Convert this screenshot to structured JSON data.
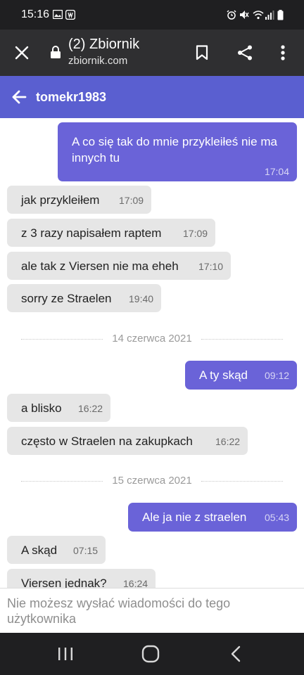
{
  "status_bar": {
    "time": "15:16"
  },
  "browser": {
    "close_icon": "close-icon",
    "lock_icon": "lock-icon",
    "title": "(2) Zbiornik",
    "url": "zbiornik.com",
    "bookmark_icon": "bookmark-icon",
    "share_icon": "share-icon",
    "menu_icon": "more-vert-icon"
  },
  "chat_header": {
    "back_icon": "arrow-left-icon",
    "username": "tomekr1983"
  },
  "messages": [
    {
      "dir": "out",
      "lines": [
        "A co się tak do mnie przykleiłeś nie ma",
        "innych tu"
      ],
      "time": "17:04"
    },
    {
      "dir": "in",
      "text": "jak przykleiłem",
      "time": "17:09"
    },
    {
      "dir": "in",
      "text": "z 3 razy napisałem raptem",
      "time": "17:09"
    },
    {
      "dir": "in",
      "text": "ale tak z Viersen nie ma eheh",
      "time": "17:10"
    },
    {
      "dir": "in",
      "text": "sorry ze Straelen",
      "time": "19:40"
    },
    {
      "date": "14 czerwca 2021"
    },
    {
      "dir": "out",
      "text": "A ty skąd",
      "time": "09:12"
    },
    {
      "dir": "in",
      "text": "a blisko",
      "time": "16:22"
    },
    {
      "dir": "in",
      "text": "często w Straelen na zakupkach",
      "time": "16:22"
    },
    {
      "date": "15 czerwca 2021"
    },
    {
      "dir": "out",
      "text": "Ale ja nie z straelen",
      "time": "05:43"
    },
    {
      "dir": "in",
      "text": "A skąd",
      "time": "07:15"
    },
    {
      "dir": "in",
      "text": "Viersen jednak?",
      "time": "16:24"
    }
  ],
  "compose": {
    "notice": "Nie możesz wysłać wiadomości do tego użytkownika"
  },
  "colors": {
    "accent": "#5a5fd0",
    "outgoing_bubble": "#6a63d8",
    "incoming_bubble": "#e6e6e6"
  }
}
